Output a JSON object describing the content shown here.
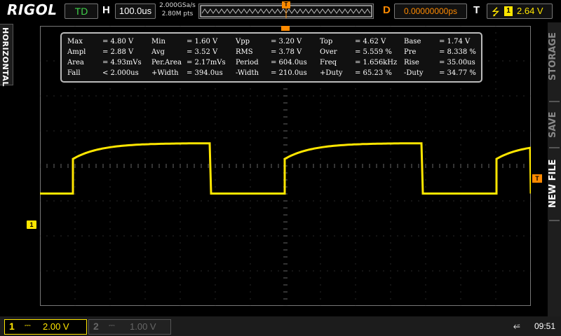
{
  "header": {
    "brand": "RIGOL",
    "run_state": "TD",
    "h_label": "H",
    "timebase": "100.0us",
    "sample_rate": "2.000GSa/s",
    "memory_depth": "2.80M pts",
    "d_label": "D",
    "trigger_delay": "0.00000000ps",
    "t_label": "T",
    "trigger_source": "1",
    "trigger_level": "2.64 V",
    "colors": {
      "delay": "#ff8a00",
      "channel1": "#ffe600",
      "run_state": "#3fd24a"
    }
  },
  "left_tab": {
    "label": "HORIZONTAL"
  },
  "right_menu": {
    "items": [
      "STORAGE",
      "SAVE",
      "NEW FILE"
    ]
  },
  "markers": {
    "ch1": "1",
    "trigger": "T",
    "trigger_pos": "T"
  },
  "measurements": {
    "rows": [
      [
        {
          "name": "Max",
          "value": "= 4.80 V"
        },
        {
          "name": "Min",
          "value": "= 1.60 V"
        },
        {
          "name": "Vpp",
          "value": "= 3.20 V"
        },
        {
          "name": "Top",
          "value": "= 4.62 V"
        },
        {
          "name": "Base",
          "value": "= 1.74 V"
        }
      ],
      [
        {
          "name": "Ampl",
          "value": "= 2.88 V"
        },
        {
          "name": "Avg",
          "value": "= 3.52 V"
        },
        {
          "name": "RMS",
          "value": "= 3.78 V"
        },
        {
          "name": "Over",
          "value": "= 5.559 %"
        },
        {
          "name": "Pre",
          "value": "= 8.338 %"
        }
      ],
      [
        {
          "name": "Area",
          "value": "= 4.93mVs"
        },
        {
          "name": "Per.Area",
          "value": "= 2.17mVs"
        },
        {
          "name": "Period",
          "value": "= 604.0us"
        },
        {
          "name": "Freq",
          "value": "= 1.656kHz"
        },
        {
          "name": "Rise",
          "value": "= 35.00us"
        }
      ],
      [
        {
          "name": "Fall",
          "value": "< 2.000us"
        },
        {
          "name": "+Width",
          "value": "= 394.0us"
        },
        {
          "name": "-Width",
          "value": "= 210.0us"
        },
        {
          "name": "+Duty",
          "value": "= 65.23 %"
        },
        {
          "name": "-Duty",
          "value": "= 34.77 %"
        }
      ]
    ]
  },
  "footer": {
    "ch1": {
      "number": "1",
      "coupling_icon": "dc-coupling-icon",
      "scale": "2.00 V"
    },
    "ch2": {
      "number": "2",
      "coupling_icon": "dc-coupling-icon",
      "scale": "1.00 V"
    },
    "usb_icon": "usb-icon",
    "time": "09:51"
  },
  "waveform": {
    "volts_per_div": 2.0,
    "ground_level_v": 0,
    "low_v": 1.74,
    "top_v": 4.62,
    "max_v": 4.8,
    "period_us": 604.0,
    "high_width_us": 394.0,
    "low_width_us": 210.0,
    "us_per_div": 100.0
  }
}
